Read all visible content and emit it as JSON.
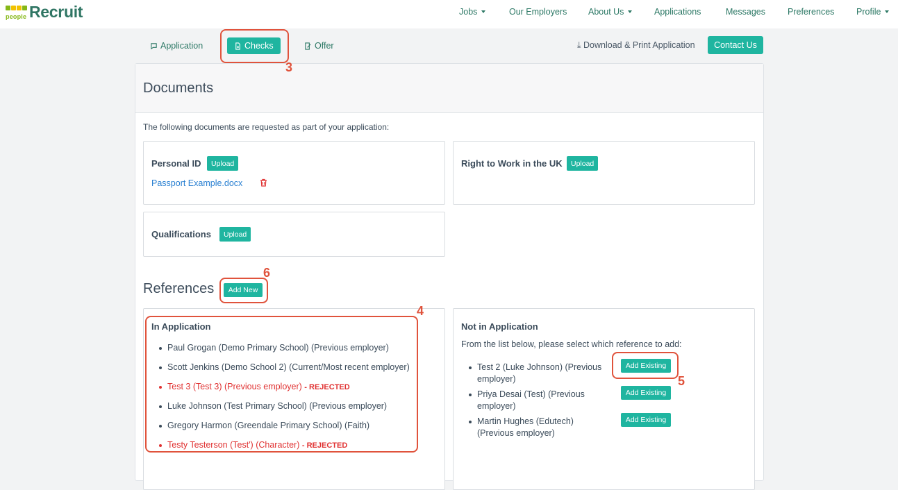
{
  "brand": {
    "name": "Recruit",
    "tag": "people",
    "block_colors": [
      "#86b817",
      "#f2c200",
      "#f2c200",
      "#86b817"
    ]
  },
  "nav": {
    "jobs": "Jobs",
    "employers": "Our Employers",
    "about": "About Us",
    "applications": "Applications",
    "messages": "Messages",
    "preferences": "Preferences",
    "profile": "Profile"
  },
  "tabs": {
    "application": "Application",
    "checks": "Checks",
    "offer": "Offer"
  },
  "actions": {
    "download": "Download & Print Application",
    "contact": "Contact Us"
  },
  "documents": {
    "title": "Documents",
    "intro": "The following documents are requested as part of your application:",
    "upload_label": "Upload",
    "personal_id": {
      "label": "Personal ID",
      "file": "Passport Example.docx"
    },
    "right_to_work": {
      "label": "Right to Work in the UK"
    },
    "qualifications": {
      "label": "Qualifications"
    }
  },
  "references": {
    "title": "References",
    "add_new": "Add New",
    "in_application": {
      "title": "In Application",
      "items": [
        {
          "text": "Paul Grogan (Demo Primary School) (Previous employer)",
          "status": ""
        },
        {
          "text": "Scott Jenkins (Demo School 2) (Current/Most recent employer)",
          "status": ""
        },
        {
          "text": "Test 3 (Test 3) (Previous employer)",
          "status": "- REJECTED"
        },
        {
          "text": "Luke Johnson (Test Primary School) (Previous employer)",
          "status": ""
        },
        {
          "text": "Gregory Harmon (Greendale Primary School) (Faith)",
          "status": ""
        },
        {
          "text": "Testy Testerson (Test') (Character)",
          "status": "- REJECTED"
        }
      ]
    },
    "not_in_application": {
      "title": "Not in Application",
      "intro": "From the list below, please select which reference to add:",
      "add_existing": "Add Existing",
      "items": [
        "Test 2 (Luke Johnson) (Previous employer)",
        "Priya Desai (Test) (Previous employer)",
        "Martin Hughes (Edutech) (Previous employer)"
      ]
    }
  },
  "annotations": {
    "a3": "3",
    "a4": "4",
    "a5": "5",
    "a6": "6",
    "color": "#e0533c"
  },
  "colors": {
    "accent": "#1fb5a0",
    "link": "#2a80d2",
    "rejected": "#e03131",
    "nav_text": "#2c7865"
  }
}
